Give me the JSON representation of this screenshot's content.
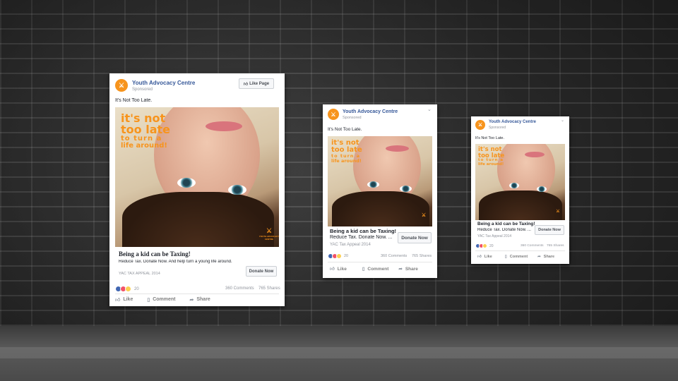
{
  "colors": {
    "brand": "#f7941d",
    "link": "#365899"
  },
  "ad": {
    "page_name": "Youth Advocacy Centre",
    "sponsored": "Sponsored",
    "like_page": "Like Page",
    "post_text": "It's Not Too Late.",
    "image_headline_lines": [
      "it's not",
      "too late",
      "to turn a",
      "life around!"
    ],
    "image_badge": "YOUTH ADVOCACY CENTRE",
    "link_title": "Being a kid can be Taxing!",
    "link_desc_full": "Reduce Tax. Donate Now. And help turn a young life around.",
    "link_desc_short": "Reduce Tax. Donate Now. ...",
    "caption_upper": "YAC TAX APPEAL 2014",
    "caption": "YAC Tax Appeal 2014",
    "cta": "Donate Now",
    "reaction_count": "20",
    "comments": "360 Comments",
    "shares": "765 Shares",
    "actions": {
      "like": "Like",
      "comment": "Comment",
      "share": "Share"
    },
    "icons": {
      "like": "thumbs-up-icon",
      "comment": "comment-icon",
      "share": "share-icon",
      "caret": "chevron-down-icon"
    }
  }
}
